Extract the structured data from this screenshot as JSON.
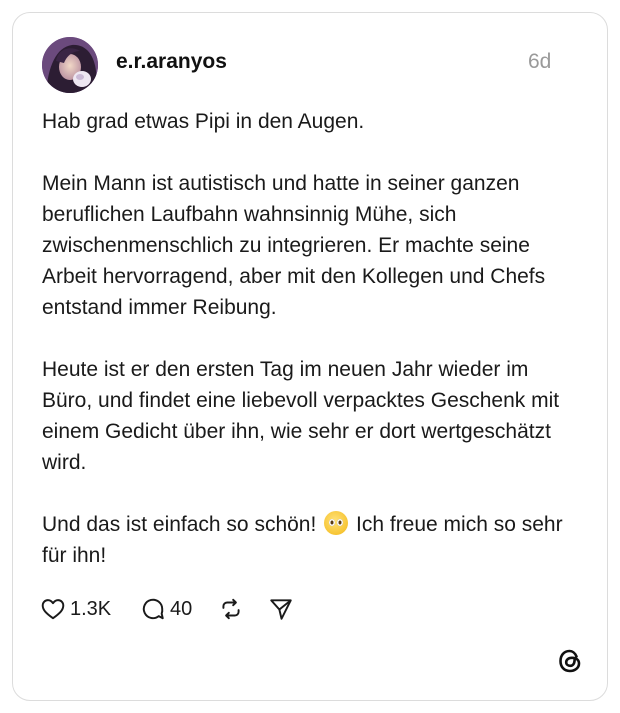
{
  "post": {
    "username": "e.r.aranyos",
    "time": "6d",
    "paragraphs": [
      "Hab grad etwas Pipi in den Augen.",
      "Mein Mann ist autistisch und hatte in seiner ganzen beruflichen Laufbahn wahnsinnig Mühe, sich zwischenmenschlich zu integrieren. Er machte seine Arbeit hervorragend, aber mit den Kollegen und Chefs entstand immer Reibung.",
      "Heute ist er den ersten Tag im neuen Jahr wieder im Büro, und findet eine liebevoll verpacktes Geschenk mit einem Gedicht über ihn, wie sehr er dort wertgeschätzt wird."
    ],
    "last_paragraph_before_emoji": "Und das ist einfach so schön!",
    "emoji": "pleading-face-emoji",
    "last_paragraph_after_emoji": " Ich freue mich so sehr für ihn!"
  },
  "actions": {
    "likes": "1.3K",
    "replies": "40",
    "like_icon": "heart-icon",
    "reply_icon": "speech-bubble-icon",
    "repost_icon": "repost-icon",
    "share_icon": "send-icon"
  },
  "brand": {
    "logo": "threads-logo-icon"
  }
}
